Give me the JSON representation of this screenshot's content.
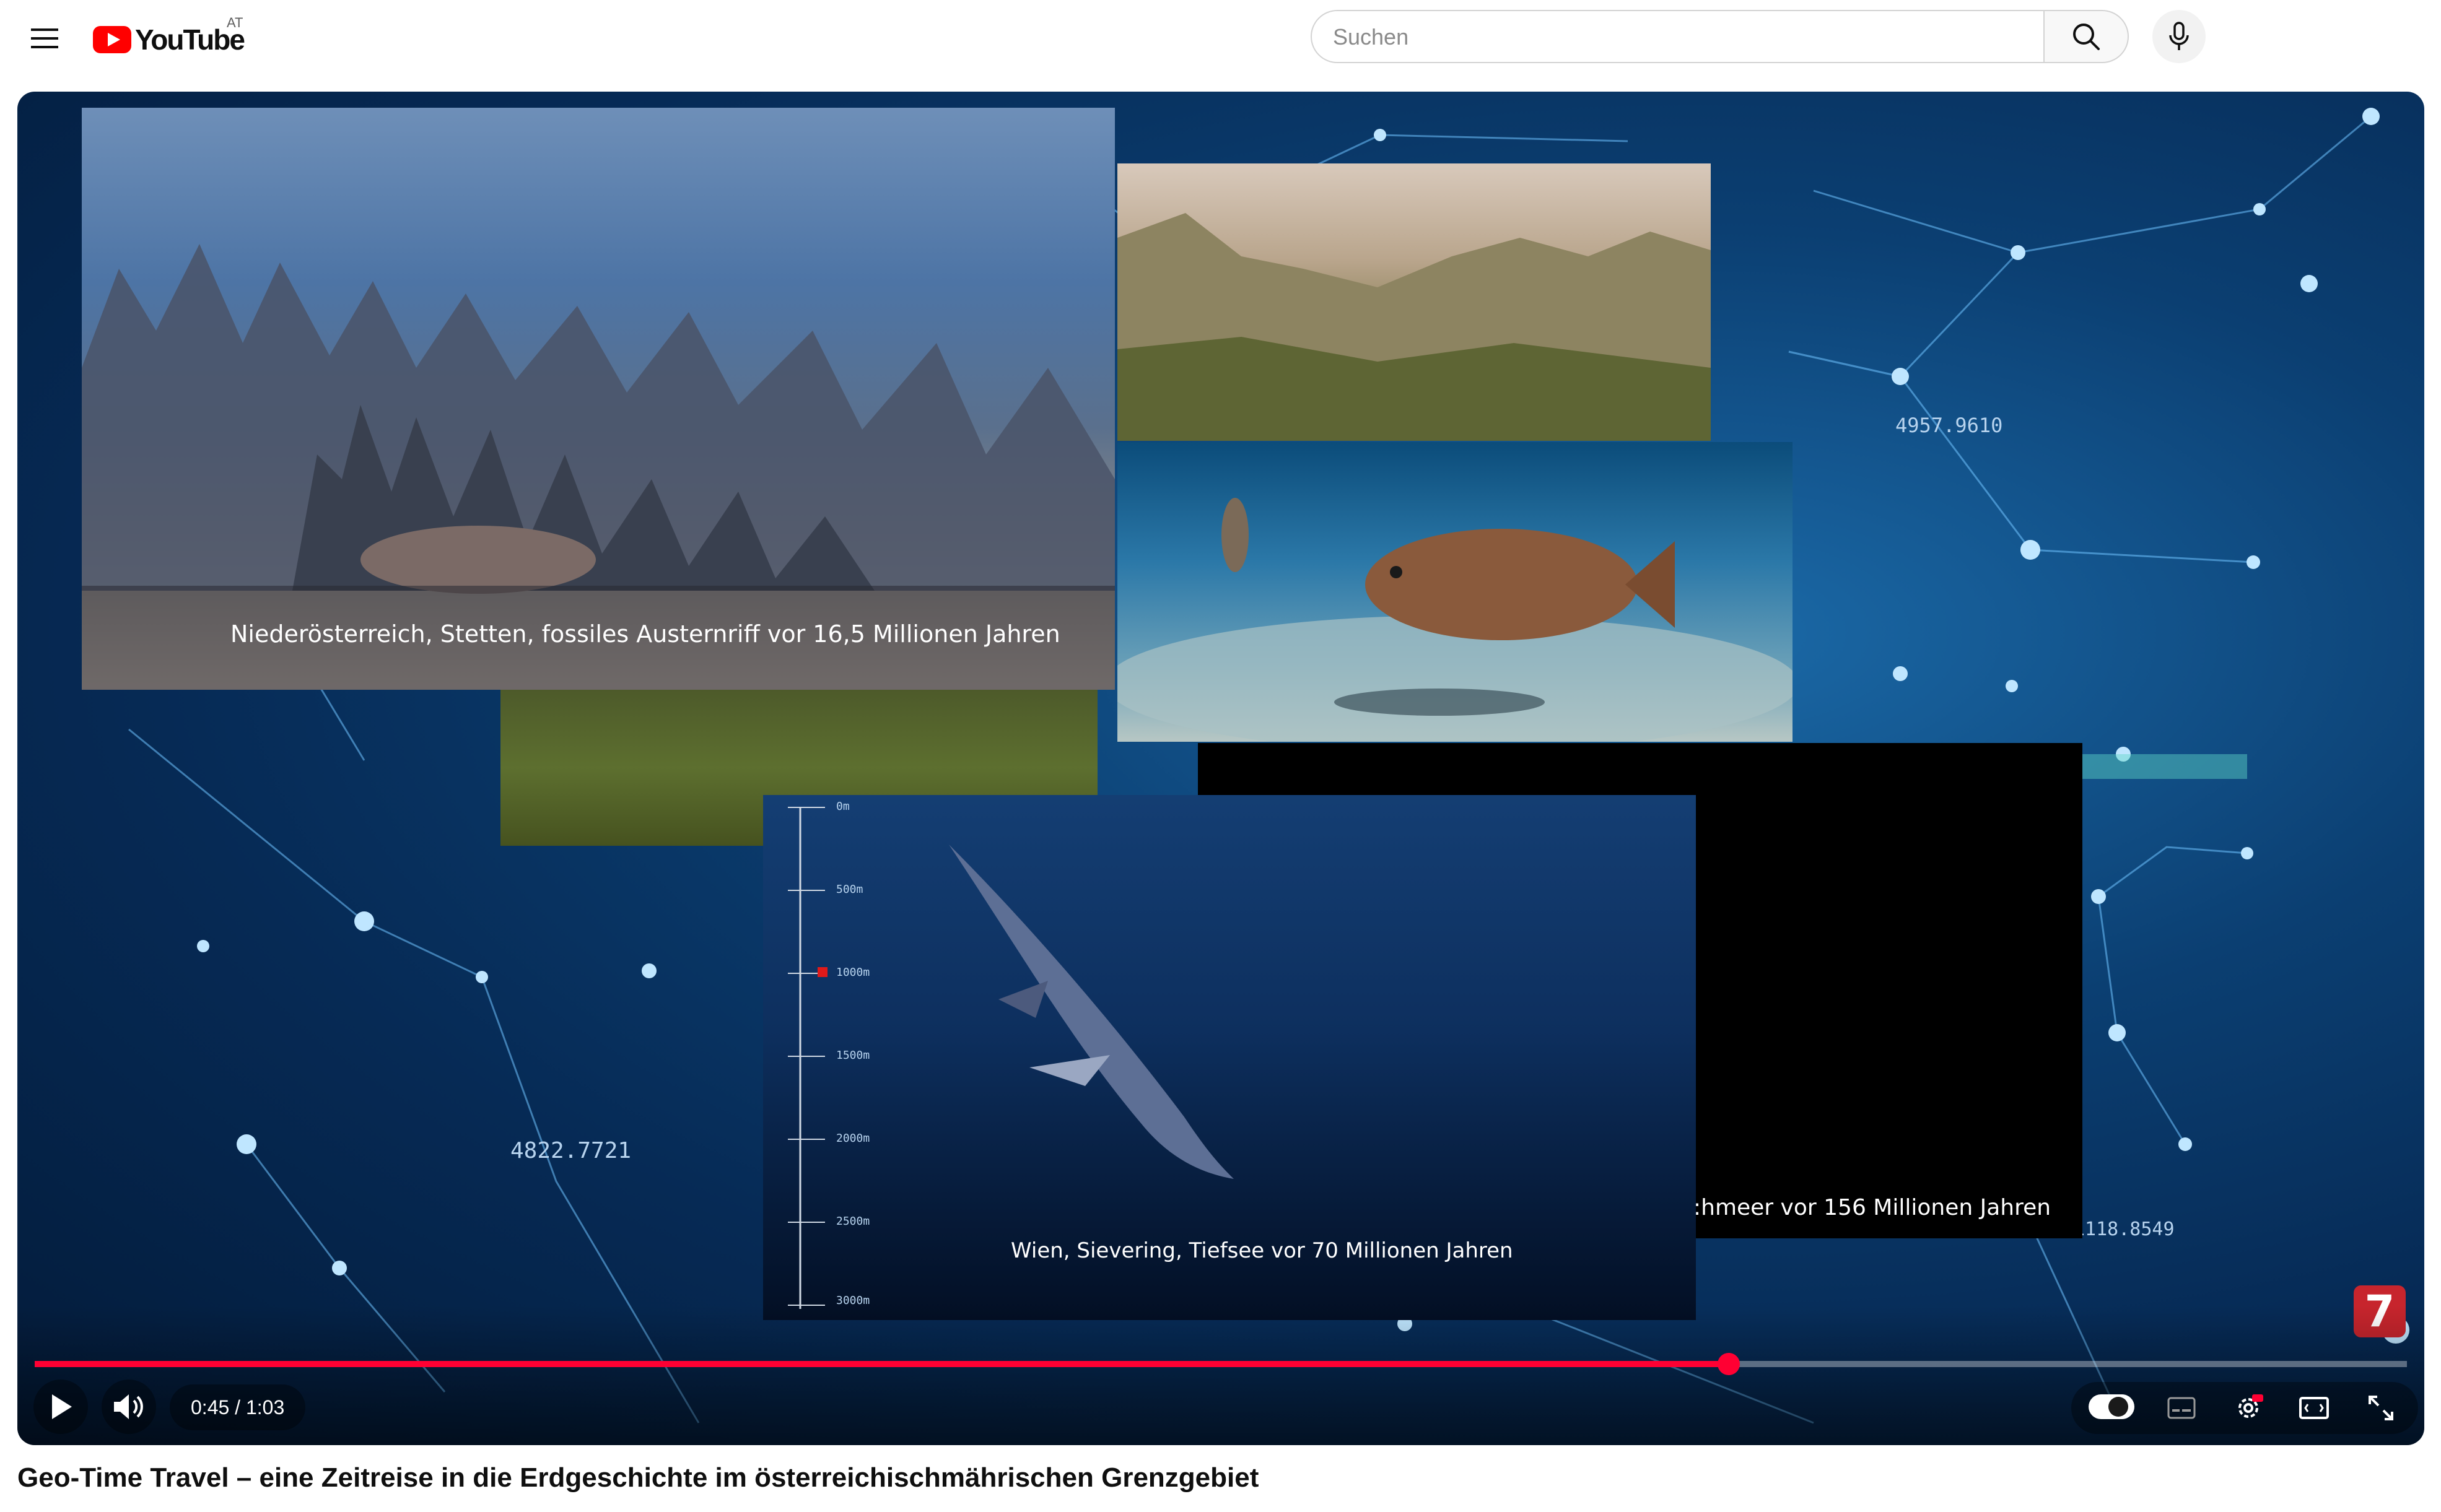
{
  "header": {
    "logo_text": "YouTube",
    "country_code": "AT",
    "search_placeholder": "Suchen"
  },
  "video": {
    "panels": {
      "reef_caption": "Niederösterreich, Stetten, fossiles Austernriff vor  16,5 Millionen Jahren",
      "black_caption": ":hmeer vor 156 Millionen Jahren",
      "deep_caption": "Wien, Sievering, Tiefsee vor 70 Millionen Jahren"
    },
    "depth_scale": [
      "0m",
      "500m",
      "1000m",
      "1500m",
      "2000m",
      "2500m",
      "3000m"
    ],
    "background_numbers": [
      "4957.9610",
      "4822.7721",
      "1118.8549"
    ],
    "channel_badge": "7"
  },
  "player": {
    "progress_fraction": 0.714,
    "time_display": "0:45 / 1:03",
    "accent_color": "#ff0033"
  },
  "title": "Geo-Time Travel – eine Zeitreise in die Erdgeschichte im österreichischmährischen Grenzgebiet"
}
